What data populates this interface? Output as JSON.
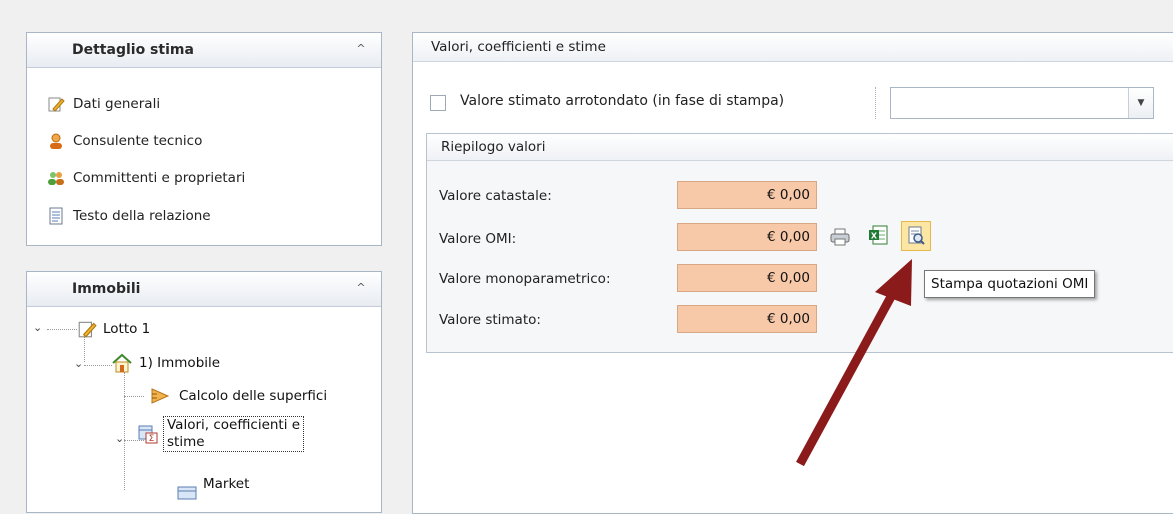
{
  "left_panel": {
    "dettaglio": {
      "title": "Dettaglio stima",
      "items": [
        {
          "label": "Dati generali",
          "icon": "pencil-icon"
        },
        {
          "label": "Consulente tecnico",
          "icon": "person-icon"
        },
        {
          "label": "Committenti e proprietari",
          "icon": "people-icon"
        },
        {
          "label": "Testo della relazione",
          "icon": "document-icon"
        }
      ]
    },
    "immobili": {
      "title": "Immobili",
      "tree": [
        {
          "label": "Lotto 1",
          "icon": "pencil-icon"
        },
        {
          "label": "1) Immobile",
          "icon": "house-icon"
        },
        {
          "label": "Calcolo delle superfici",
          "icon": "ruler-icon"
        },
        {
          "label_line1": "Valori, coefficienti e",
          "label_line2": "stime",
          "icon": "sigma-table-icon"
        },
        {
          "label": "Market",
          "icon": "table-icon"
        }
      ]
    }
  },
  "main": {
    "title": "Valori, coefficienti e stime",
    "rounded_checkbox": {
      "label": "Valore stimato arrotondato (in fase di stampa)",
      "checked": false
    },
    "rounding_select": {
      "value": ""
    },
    "riepilogo": {
      "title": "Riepilogo valori",
      "rows": [
        {
          "label": "Valore catastale:",
          "value": "€ 0,00"
        },
        {
          "label": "Valore OMI:",
          "value": "€ 0,00"
        },
        {
          "label": "Valore monoparametrico:",
          "value": "€ 0,00"
        },
        {
          "label": "Valore stimato:",
          "value": "€ 0,00"
        }
      ],
      "omi_actions": [
        "printer-icon",
        "excel-icon",
        "print-preview-icon"
      ]
    },
    "tooltip": "Stampa quotazioni OMI"
  },
  "colors": {
    "value_bg": "#f8c9a8",
    "arrow": "#8b1a1a"
  }
}
